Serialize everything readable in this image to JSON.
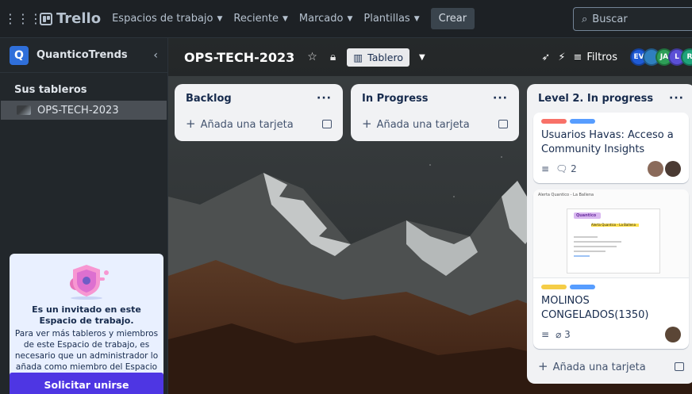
{
  "topbar": {
    "brand": "Trello",
    "nav": [
      "Espacios de trabajo",
      "Reciente",
      "Marcado",
      "Plantillas"
    ],
    "create_label": "Crear",
    "search_placeholder": "Buscar"
  },
  "sidebar": {
    "workspace_letter": "Q",
    "workspace_name": "QuanticoTrends",
    "boards_title": "Sus tableros",
    "boards": [
      "OPS-TECH-2023"
    ],
    "invite": {
      "title": "Es un invitado en este Espacio de trabajo.",
      "body": "Para ver más tableros y miembros de este Espacio de trabajo, es necesario que un administrador lo añada como miembro del Espacio de trabajo.",
      "button": "Solicitar unirse"
    }
  },
  "board": {
    "name": "OPS-TECH-2023",
    "view_label": "Tablero",
    "filters_label": "Filtros",
    "members": [
      {
        "initials": "EV",
        "color": "#1f5bd6"
      },
      {
        "initials": "",
        "color": "#2f7fbf"
      },
      {
        "initials": "JA",
        "color": "#2e9e57"
      },
      {
        "initials": "L",
        "color": "#5b4fd6"
      },
      {
        "initials": "R",
        "color": "#1fa37a"
      }
    ],
    "lists": [
      {
        "title": "Backlog",
        "add_label": "Añada una tarjeta",
        "cards": []
      },
      {
        "title": "In Progress",
        "add_label": "Añada una tarjeta",
        "cards": []
      },
      {
        "title": "Level 2. In progress",
        "add_label": "Añada una tarjeta",
        "cards": [
          {
            "labels": [
              "#f87168",
              "#579dff"
            ],
            "title": "Usuarios Havas: Acceso a Community Insights",
            "comments": "2"
          },
          {
            "labels": [
              "#f5cd47",
              "#579dff"
            ],
            "title": "MOLINOS CONGELADOS(1350)",
            "attachments": "3",
            "cover_from": "Alerta Quantico - La Ballena",
            "cover_brand": "Quantico",
            "cover_heading": "Alerta Quantico - La Ballena"
          }
        ]
      }
    ]
  }
}
